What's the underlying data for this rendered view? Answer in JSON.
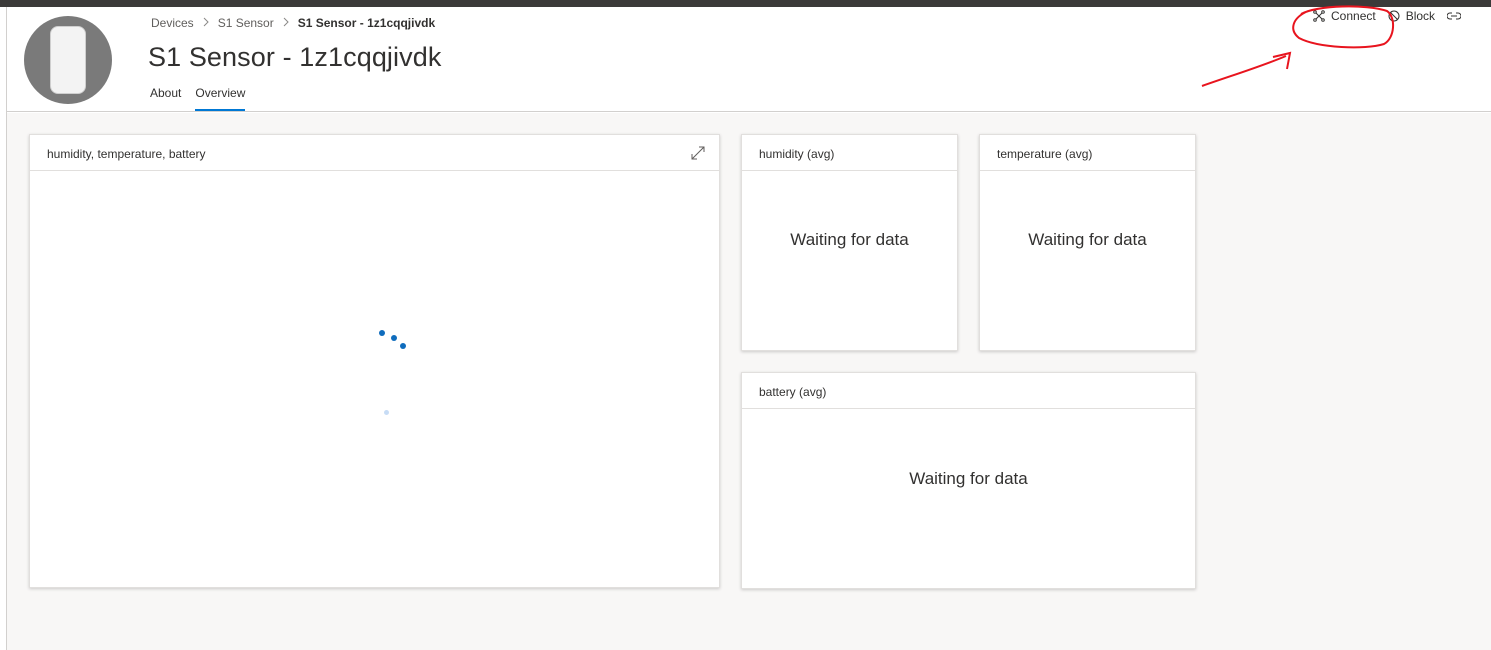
{
  "breadcrumb": {
    "items": [
      "Devices",
      "S1 Sensor"
    ],
    "current": "S1 Sensor - 1z1cqqjivdk"
  },
  "page": {
    "title": "S1 Sensor - 1z1cqqjivdk"
  },
  "tabs": [
    {
      "label": "About",
      "active": false
    },
    {
      "label": "Overview",
      "active": true
    }
  ],
  "actions": {
    "connect_label": "Connect",
    "block_label": "Block"
  },
  "tiles": {
    "main": {
      "title": "humidity, temperature, battery"
    },
    "humidity": {
      "title": "humidity (avg)",
      "status": "Waiting for data"
    },
    "temperature": {
      "title": "temperature (avg)",
      "status": "Waiting for data"
    },
    "battery": {
      "title": "battery (avg)",
      "status": "Waiting for data"
    }
  },
  "colors": {
    "accent": "#0078d4",
    "annotation": "#e8141e",
    "spinner": "#0f6cbd"
  },
  "icons": [
    "breadcrumb-chevron-icon",
    "connect-icon",
    "block-icon",
    "more-action-icon",
    "expand-icon"
  ]
}
